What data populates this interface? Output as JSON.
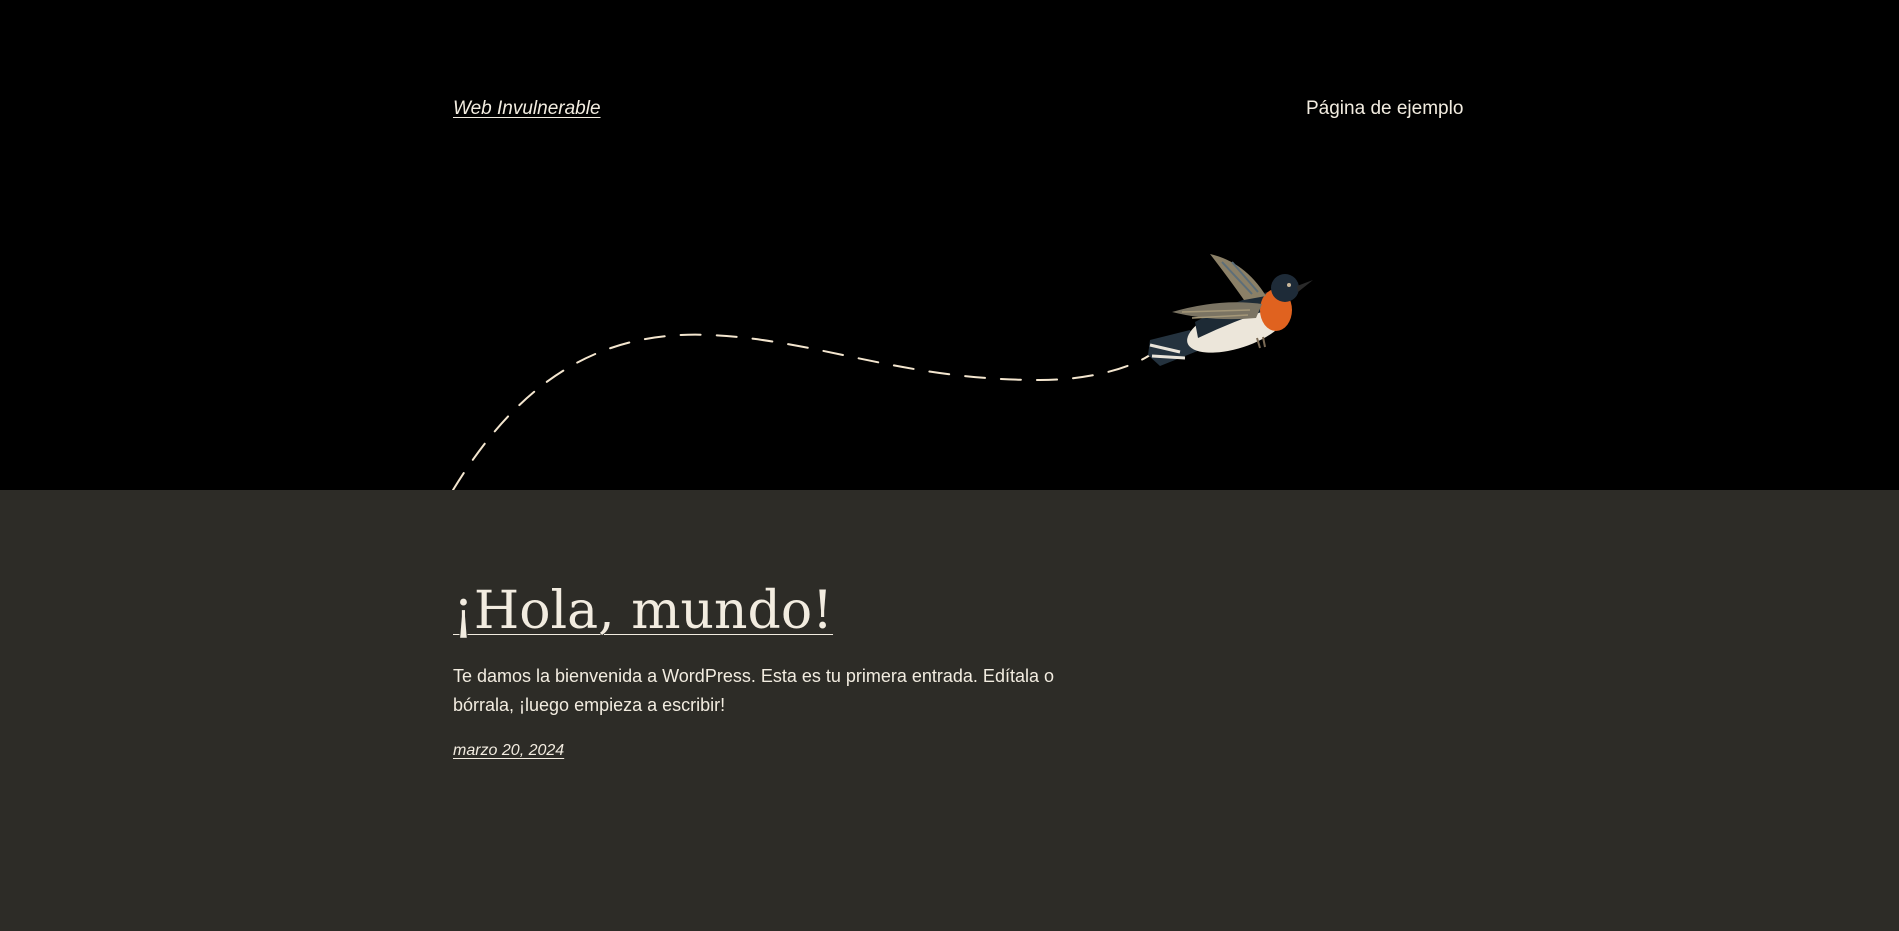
{
  "header": {
    "site_title": "Web Invulnerable",
    "nav_items": [
      {
        "label": "Página de ejemplo"
      }
    ]
  },
  "hero": {
    "illustration": "hummingbird-flight-path"
  },
  "post": {
    "title": "¡Hola, mundo!",
    "excerpt": "Te damos la bienvenida a WordPress. Esta es tu primera entrada. Edítala o bórrala, ¡luego empieza a escribir!",
    "date": "marzo 20, 2024"
  },
  "colors": {
    "header_background": "#000000",
    "page_background": "#2d2c27",
    "text": "#f2ece0",
    "bird_breast": "#e0621f",
    "bird_back": "#1d2a35"
  }
}
